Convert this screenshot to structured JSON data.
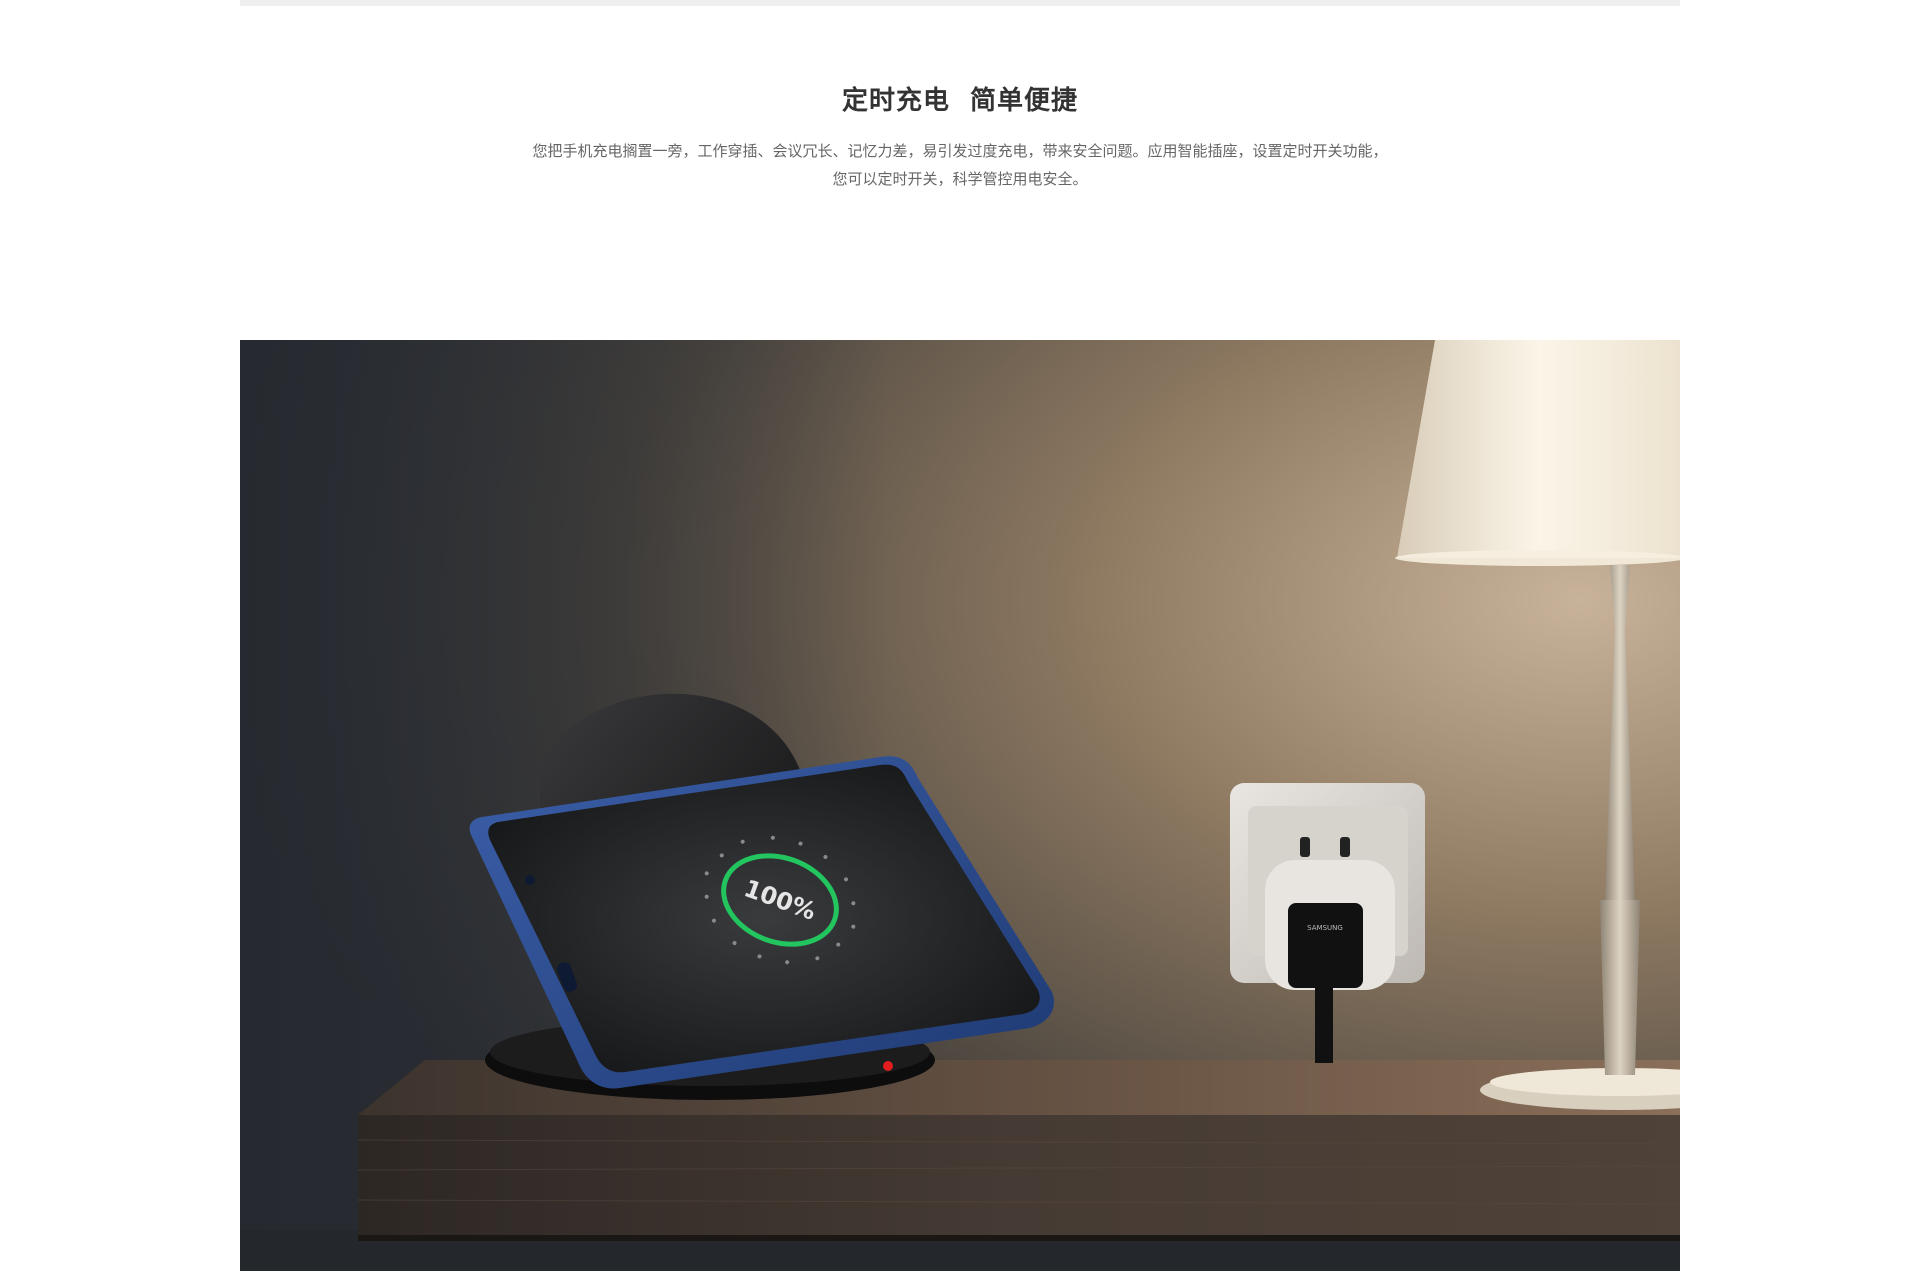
{
  "section": {
    "headline": "定时充电  简单便捷",
    "description_lines": [
      "您把手机充电搁置一旁，工作穿插、会议冗长、记忆力差，易引发过度充电，带来安全问题。应用智能插座，设置定时开关功能，",
      "您可以定时开关，科学管控用电安全。"
    ]
  },
  "hero_image": {
    "phone_screen_text": "100%",
    "charger_brand_text": "SAMSUNG",
    "ring_color": "#22c55e",
    "indicator_color": "#e11d1d"
  }
}
